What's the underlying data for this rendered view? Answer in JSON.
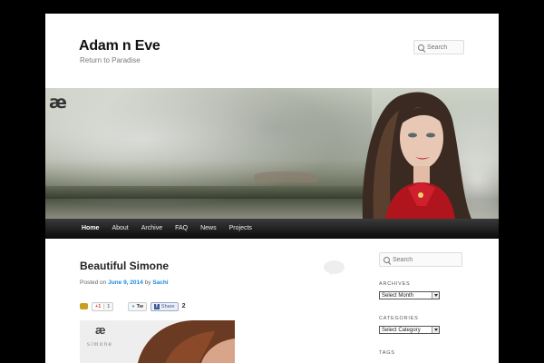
{
  "site": {
    "title": "Adam n Eve",
    "description": "Return to Paradise"
  },
  "header_search": {
    "placeholder": "Search"
  },
  "header_image": {
    "logo_text": "æ"
  },
  "nav": {
    "items": [
      {
        "label": "Home",
        "active": true
      },
      {
        "label": "About"
      },
      {
        "label": "Archive"
      },
      {
        "label": "FAQ"
      },
      {
        "label": "News"
      },
      {
        "label": "Projects"
      }
    ]
  },
  "post": {
    "title": "Beautiful Simone",
    "meta_prefix": "Posted on",
    "date": "June 9, 2014",
    "by": "by",
    "author": "Sachi",
    "share": {
      "gplus_label": "+1",
      "gplus_count": "1",
      "twitter_label": "Tw",
      "facebook_label": "Share",
      "total_count": "2"
    },
    "image": {
      "logo_text": "æ",
      "caption": "simone"
    }
  },
  "sidebar": {
    "search_placeholder": "Search",
    "archives_title": "ARCHIVES",
    "archives_select": "Select Month",
    "categories_title": "CATEGORIES",
    "categories_select": "Select Category",
    "tags_title": "TAGS"
  }
}
